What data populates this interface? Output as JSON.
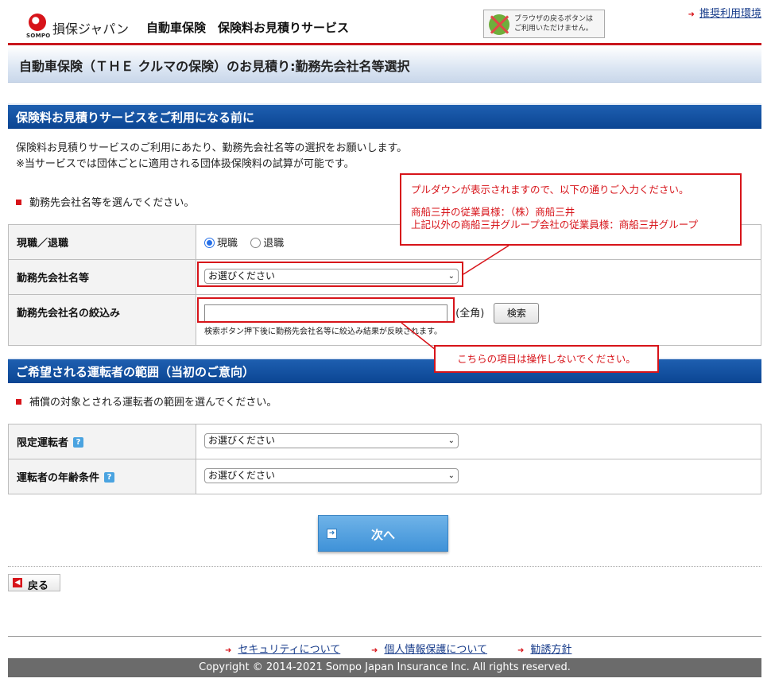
{
  "header": {
    "logo_text": "損保ジャパン",
    "logo_small": "SOMPO",
    "title": "自動車保険　保険料お見積りサービス",
    "browser_note_line1": "ブラウザの戻るボタンは",
    "browser_note_line2": "ご利用いただけません。",
    "recommended_env": "推奨利用環境"
  },
  "page_title": "自動車保険（ＴＨＥ クルマの保険）のお見積り:勤務先会社名等選択",
  "section1": {
    "title": "保険料お見積りサービスをご利用になる前に",
    "para1": "保険料お見積りサービスのご利用にあたり、勤務先会社名等の選択をお願いします。",
    "para2": "※当サービスでは団体ごとに適用される団体扱保険料の試算が可能です。",
    "instruction": "勤務先会社名等を選んでください。",
    "rows": {
      "status_label": "現職／退職",
      "radio_current": "現職",
      "radio_retired": "退職",
      "company_label": "勤務先会社名等",
      "company_select": "お選びください",
      "filter_label": "勤務先会社名の絞込み",
      "filter_suffix": "(全角)",
      "search_button": "検索",
      "filter_note": "検索ボタン押下後に勤務先会社名等に絞込み結果が反映されます。"
    }
  },
  "callout1": {
    "line1": "プルダウンが表示されますので、以下の通りご入力ください。",
    "line2": "商船三井の従業員様：（株）商船三井",
    "line3": "上記以外の商船三井グループ会社の従業員様：商船三井グループ"
  },
  "callout2": "こちらの項目は操作しないでください。",
  "section2": {
    "title": "ご希望される運転者の範囲（当初のご意向）",
    "instruction": "補償の対象とされる運転者の範囲を選んでください。",
    "rows": {
      "driver_label": "限定運転者",
      "driver_select": "お選びください",
      "age_label": "運転者の年齢条件",
      "age_select": "お選びください"
    }
  },
  "next_button": "次へ",
  "back_button": "戻る",
  "footer": {
    "link1": "セキュリティについて",
    "link2": "個人情報保護について",
    "link3": "勧誘方針",
    "copyright": "Copyright © 2014-2021 Sompo Japan Insurance Inc. All rights reserved."
  },
  "colors": {
    "brand_red": "#d7141a",
    "section_blue": "#0b4593",
    "link_blue": "#1a3e8c"
  },
  "icons": [
    "logo-mark",
    "no-back-icon",
    "arrow-icon",
    "help-icon",
    "next-arrow-icon",
    "back-icon"
  ]
}
